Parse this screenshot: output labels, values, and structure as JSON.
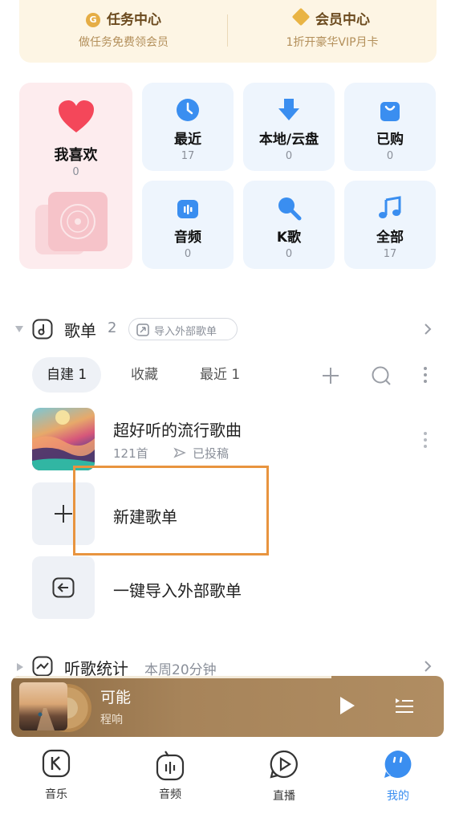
{
  "banner": {
    "left_title": "任务中心",
    "left_sub": "做任务免费领会员",
    "left_icon": "G",
    "right_title": "会员中心",
    "right_sub": "1折开豪华VIP月卡"
  },
  "quick": {
    "favorites": {
      "label": "我喜欢",
      "count": "0"
    },
    "tiles": [
      {
        "label": "最近",
        "count": "17",
        "icon": "clock-icon"
      },
      {
        "label": "本地/云盘",
        "count": "0",
        "icon": "download-arrow-icon"
      },
      {
        "label": "已购",
        "count": "0",
        "icon": "shopping-bag-icon"
      },
      {
        "label": "音频",
        "count": "0",
        "icon": "radio-icon"
      },
      {
        "label": "K歌",
        "count": "0",
        "icon": "microphone-icon"
      },
      {
        "label": "全部",
        "count": "17",
        "icon": "music-note-icon"
      }
    ]
  },
  "playlists": {
    "title": "歌单",
    "count": "2",
    "import_chip": "导入外部歌单",
    "tabs": [
      {
        "label": "自建 1",
        "active": true
      },
      {
        "label": "收藏",
        "active": false
      },
      {
        "label": "最近 1",
        "active": false
      }
    ],
    "items": [
      {
        "name": "超好听的流行歌曲",
        "songs": "121首",
        "status": "已投稿"
      }
    ],
    "new_playlist": "新建歌单",
    "import_one_click": "一键导入外部歌单"
  },
  "stats": {
    "title": "听歌统计",
    "sub": "本周20分钟"
  },
  "player": {
    "song": "可能",
    "artist": "程响",
    "progress": 0.74
  },
  "nav": [
    {
      "label": "音乐",
      "icon": "k-music-icon",
      "active": false
    },
    {
      "label": "音频",
      "icon": "audio-bars-icon",
      "active": false
    },
    {
      "label": "直播",
      "icon": "live-play-icon",
      "active": false
    },
    {
      "label": "我的",
      "icon": "profile-face-icon",
      "active": true
    }
  ],
  "colors": {
    "accent": "#3a8ef0",
    "banner_bg": "#fdf5e4",
    "tile_bg": "#eef5fd",
    "favorites_bg": "#fdecee",
    "highlight_border": "#e8943f"
  }
}
